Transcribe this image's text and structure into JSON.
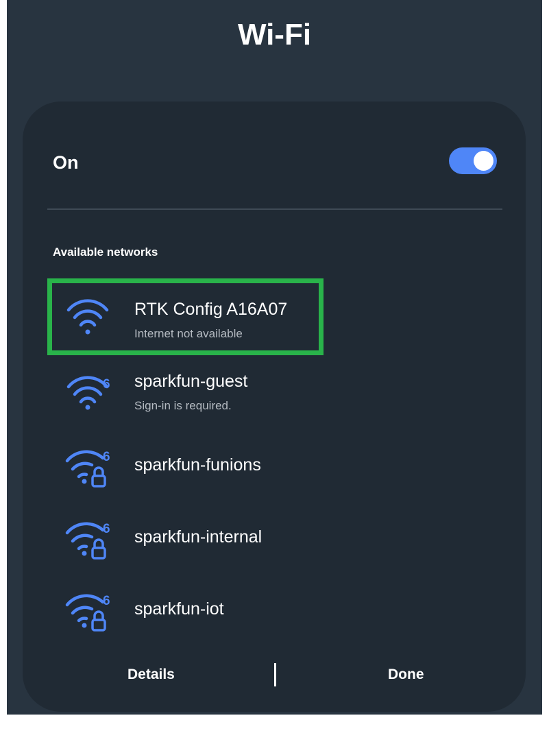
{
  "header": {
    "title": "Wi-Fi"
  },
  "toggle": {
    "label": "On",
    "state": "on",
    "accent": "#4f86f7"
  },
  "section": {
    "label": "Available networks"
  },
  "networks": [
    {
      "name": "RTK Config A16A07",
      "status": "Internet not available",
      "icon": "wifi-icon",
      "wifi6": false,
      "locked": false,
      "highlighted": true
    },
    {
      "name": "sparkfun-guest",
      "status": "Sign-in is required.",
      "icon": "wifi-6-icon",
      "wifi6": true,
      "locked": false,
      "highlighted": false
    },
    {
      "name": "sparkfun-funions",
      "status": "",
      "icon": "wifi-6-lock-icon",
      "wifi6": true,
      "locked": true,
      "highlighted": false
    },
    {
      "name": "sparkfun-internal",
      "status": "",
      "icon": "wifi-6-lock-icon",
      "wifi6": true,
      "locked": true,
      "highlighted": false
    },
    {
      "name": "sparkfun-iot",
      "status": "",
      "icon": "wifi-6-lock-icon",
      "wifi6": true,
      "locked": true,
      "highlighted": false
    }
  ],
  "footer": {
    "details_label": "Details",
    "done_label": "Done"
  },
  "colors": {
    "background": "#283440",
    "panel": "#202a34",
    "icon_blue": "#4f86f7",
    "highlight_box": "#29b34a"
  }
}
